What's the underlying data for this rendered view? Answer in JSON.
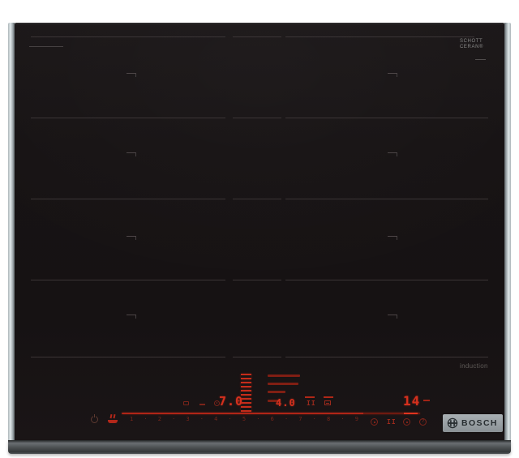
{
  "branding": {
    "schott_line1": "SCHOTT",
    "schott_line2": "CERAN®",
    "induction": "induction",
    "bosch": "BOSCH"
  },
  "displays": {
    "left_zone_power": "7.0",
    "right_zone_power": "4.0",
    "timer": "14"
  },
  "slider": {
    "items": [
      "1",
      "·",
      "2",
      "·",
      "3",
      "·",
      "4",
      "·",
      "5",
      "·",
      "6",
      "·",
      "7",
      "·",
      "8",
      "·",
      "9"
    ]
  },
  "icons": {
    "power": "circle-with-bar",
    "frying_sensor": "pan-with-heat",
    "menu_pause": "II",
    "pause": "II",
    "timer": "clock",
    "cleaning": "circle-dot",
    "info": "?"
  },
  "colors": {
    "glass": "#171314",
    "red_bright": "#d5301d",
    "red_dim": "#8c2215",
    "frame_light": "#c9d2d6",
    "frame_bottom": "#45494b",
    "bosch_plate": "#9aa1a5",
    "zone_line": "#3b3536"
  }
}
